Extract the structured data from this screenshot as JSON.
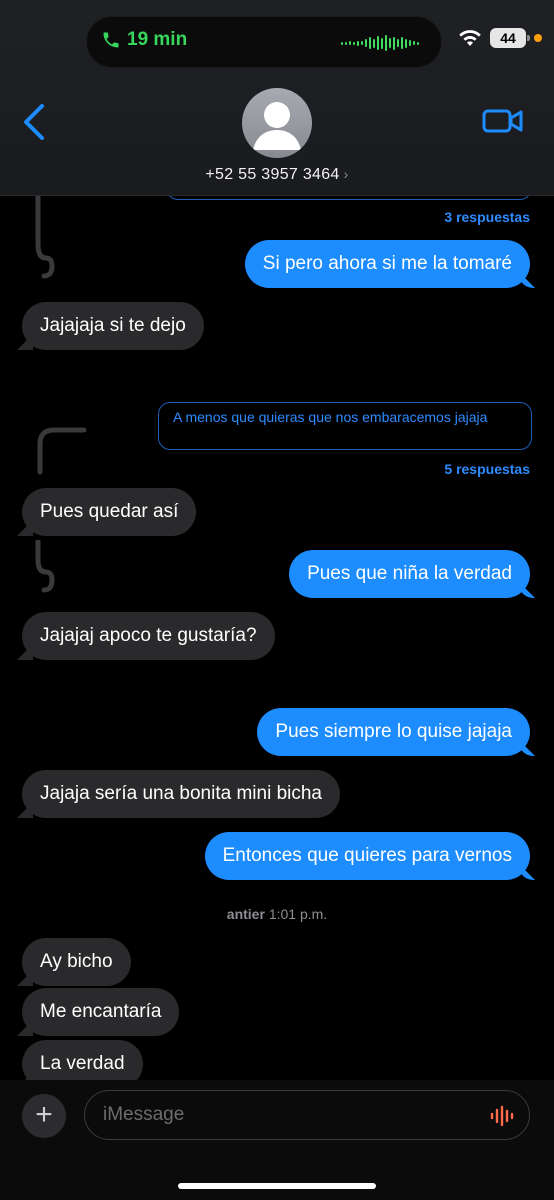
{
  "status_bar": {
    "call_duration": "19 min",
    "battery_level": "44",
    "colors": {
      "call_green": "#37d65c",
      "privacy_dot": "#ff9f0a"
    }
  },
  "header": {
    "contact_number": "+52 55 3957 3464",
    "icons": {
      "back": "chevron-left-icon",
      "video": "video-camera-icon",
      "avatar": "person-silhouette-icon"
    }
  },
  "messages": [
    {
      "kind": "thread-replies",
      "text": "3 respuestas"
    },
    {
      "kind": "out",
      "text": "Si pero ahora si me la tomaré"
    },
    {
      "kind": "in",
      "text": "Jajajaja si te dejo"
    },
    {
      "kind": "thread-preview",
      "text": "A menos que quieras que nos embaracemos jajaja"
    },
    {
      "kind": "thread-replies",
      "text": "5 respuestas"
    },
    {
      "kind": "in",
      "text": "Pues quedar así"
    },
    {
      "kind": "out",
      "text": "Pues que niña la verdad"
    },
    {
      "kind": "in",
      "text": "Jajajaj apoco te gustaría?"
    },
    {
      "kind": "out",
      "text": "Pues siempre lo quise jajaja"
    },
    {
      "kind": "in",
      "text": "Jajaja sería una bonita mini bicha"
    },
    {
      "kind": "out",
      "text": "Entonces que quieres para vernos"
    },
    {
      "kind": "timestamp",
      "day": "antier",
      "time": "1:01 p.m."
    },
    {
      "kind": "in",
      "text": "Ay bicho"
    },
    {
      "kind": "in",
      "text": "Me encantaría"
    },
    {
      "kind": "in",
      "text": "La verdad"
    }
  ],
  "composer": {
    "placeholder": "iMessage",
    "icons": {
      "plus": "plus-icon",
      "audio": "waveform-icon"
    },
    "colors": {
      "bubble_out": "#1c8cff",
      "bubble_in": "#2a2a2c",
      "audio_icon": "#ff6a4d"
    }
  }
}
